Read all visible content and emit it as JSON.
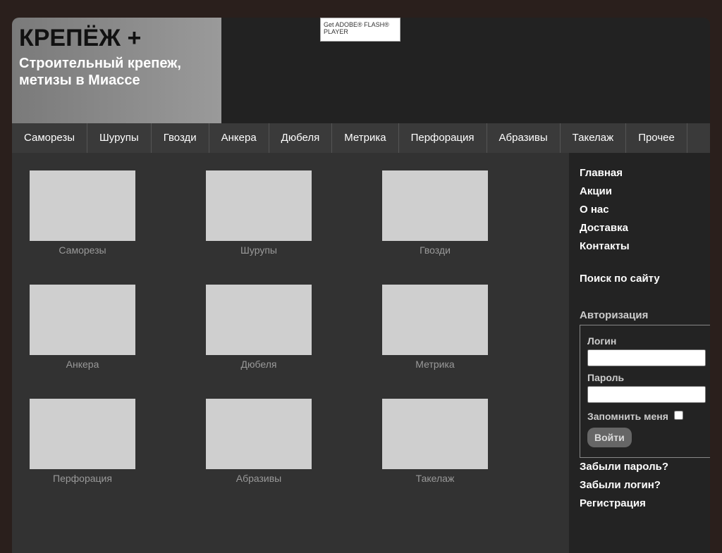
{
  "brand": {
    "title": "КРЕПЁЖ +",
    "subtitle1": "Строительный крепеж,",
    "subtitle2": "метизы в Миассе"
  },
  "flash": {
    "label": "Get ADOBE® FLASH® PLAYER"
  },
  "nav": [
    "Саморезы",
    "Шурупы",
    "Гвозди",
    "Анкера",
    "Дюбеля",
    "Метрика",
    "Перфорация",
    "Абразивы",
    "Такелаж",
    "Прочее"
  ],
  "tiles": [
    "Саморезы",
    "Шурупы",
    "Гвозди",
    "Анкера",
    "Дюбеля",
    "Метрика",
    "Перфорация",
    "Абразивы",
    "Такелаж"
  ],
  "side": {
    "links": [
      "Главная",
      "Акции",
      "О нас",
      "Доставка",
      "Контакты"
    ],
    "search": "Поиск по сайту",
    "auth": "Авторизация",
    "login": "Логин",
    "password": "Пароль",
    "remember": "Запомнить меня",
    "submit": "Войти",
    "forgot_pass": "Забыли пароль?",
    "forgot_login": "Забыли логин?",
    "register": "Регистрация"
  }
}
